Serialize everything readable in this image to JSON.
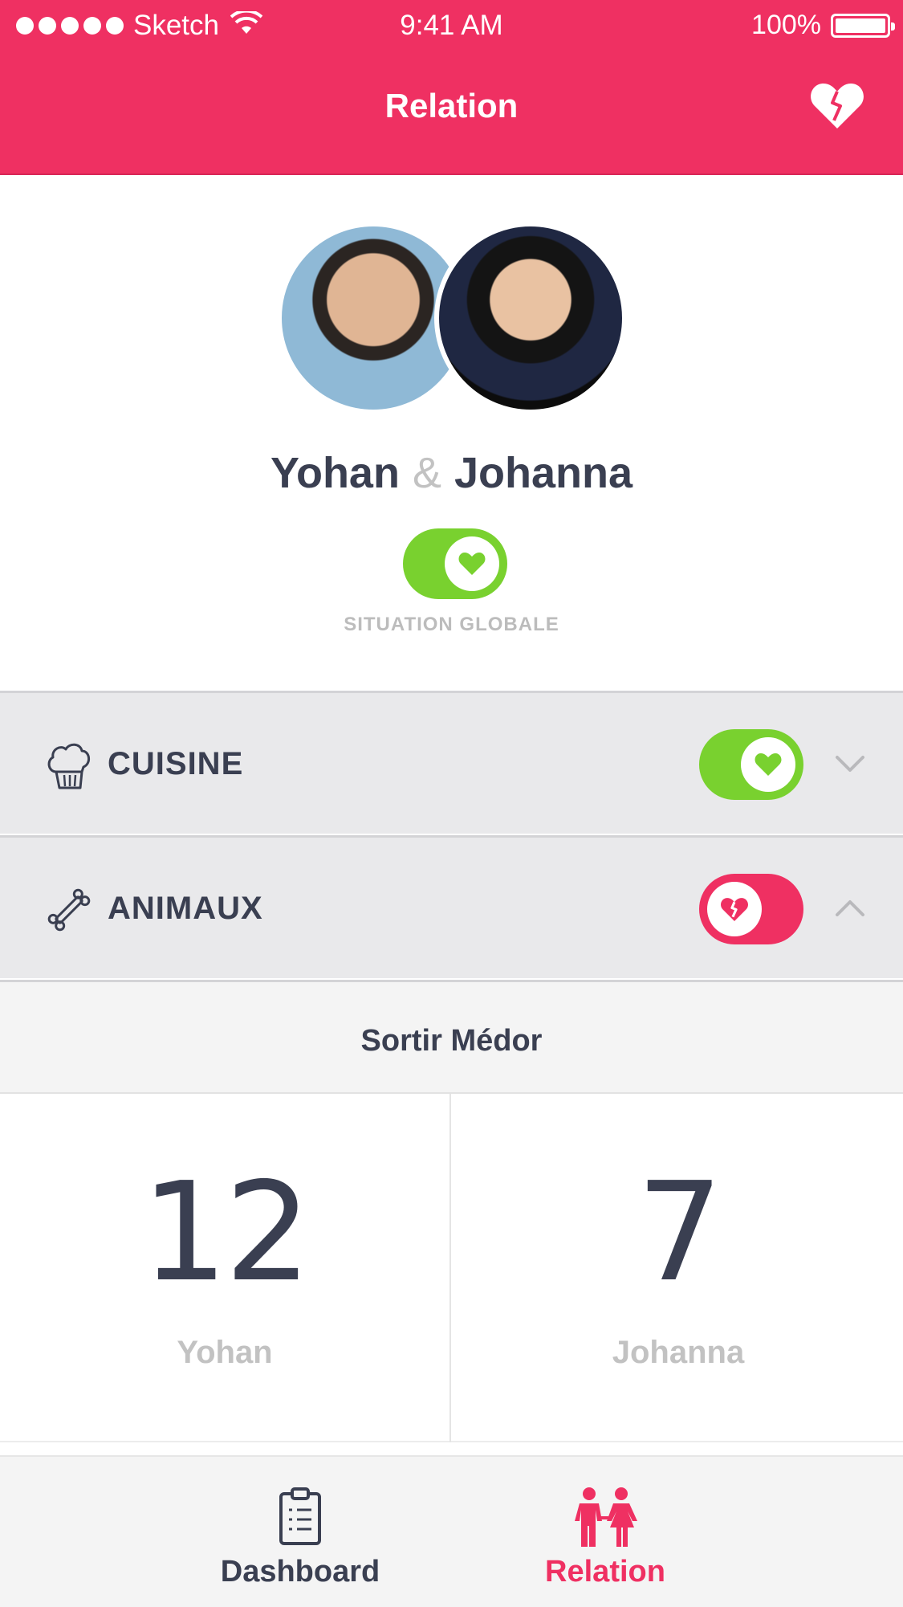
{
  "status_bar": {
    "carrier": "Sketch",
    "time": "9:41 AM",
    "battery": "100%"
  },
  "nav": {
    "title": "Relation",
    "action_icon": "broken-heart-icon"
  },
  "couple": {
    "name_1": "Yohan",
    "separator": "&",
    "name_2": "Johanna",
    "global_status": "on",
    "global_label": "SITUATION GLOBALE"
  },
  "categories": [
    {
      "label": "CUISINE",
      "icon": "chef-hat-icon",
      "status": "on",
      "expanded": false
    },
    {
      "label": "ANIMAUX",
      "icon": "bone-icon",
      "status": "off",
      "expanded": true
    }
  ],
  "task": {
    "title": "Sortir Médor",
    "scores": [
      {
        "value": "12",
        "name": "Yohan"
      },
      {
        "value": "7",
        "name": "Johanna"
      }
    ]
  },
  "tabs": [
    {
      "label": "Dashboard",
      "icon": "clipboard-icon",
      "active": false
    },
    {
      "label": "Relation",
      "icon": "couple-icon",
      "active": true
    }
  ],
  "colors": {
    "brand": "#ef3062",
    "positive": "#79d12f",
    "text": "#3a3f51",
    "muted": "#c2c2c2"
  }
}
